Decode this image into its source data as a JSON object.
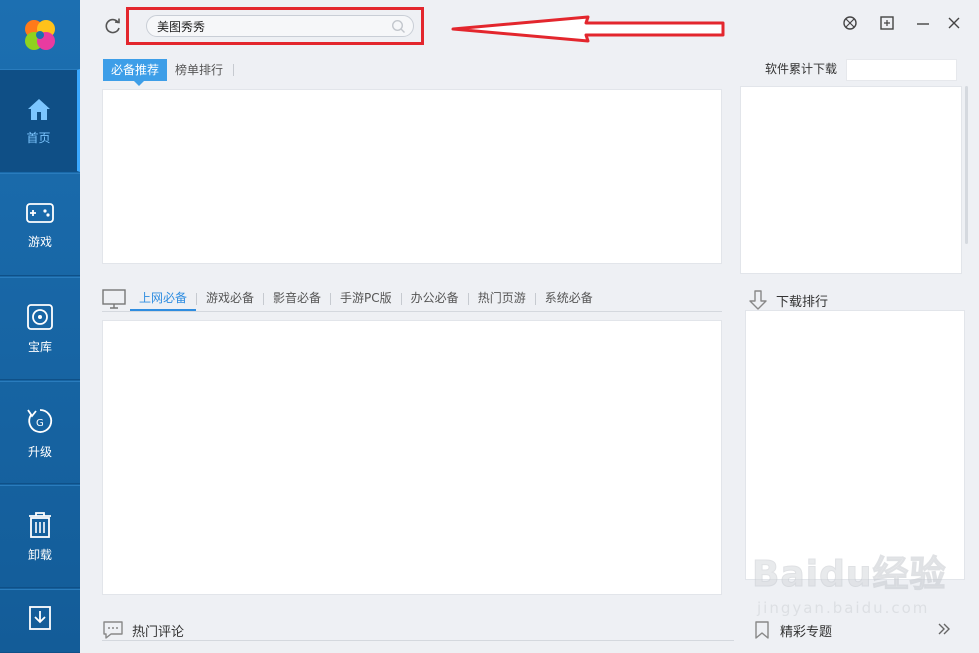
{
  "sidebar": {
    "items": [
      {
        "label": "首页",
        "icon": "home-icon",
        "active": true
      },
      {
        "label": "游戏",
        "icon": "gamepad-icon"
      },
      {
        "label": "宝库",
        "icon": "disc-icon"
      },
      {
        "label": "升级",
        "icon": "upgrade-icon"
      },
      {
        "label": "卸载",
        "icon": "trash-icon"
      },
      {
        "label": "",
        "icon": "download-icon"
      }
    ]
  },
  "search": {
    "value": "美图秀秀"
  },
  "top_tabs": [
    {
      "label": "必备推荐",
      "active": true
    },
    {
      "label": "榜单排行"
    }
  ],
  "right_top": {
    "label": "软件累计下载"
  },
  "category_tabs": [
    {
      "label": "上网必备",
      "active": true
    },
    {
      "label": "游戏必备"
    },
    {
      "label": "影音必备"
    },
    {
      "label": "手游PC版"
    },
    {
      "label": "办公必备"
    },
    {
      "label": "热门页游"
    },
    {
      "label": "系统必备"
    }
  ],
  "download_rank": {
    "label": "下载排行"
  },
  "hot_comments": {
    "label": "热门评论"
  },
  "featured": {
    "label": "精彩专题"
  },
  "watermark": {
    "brand": "Baidu经验",
    "url": "jingyan.baidu.com"
  },
  "colors": {
    "sidebar": "#1c6fb1",
    "accent": "#3d9ee8",
    "highlight": "#e3262d"
  }
}
